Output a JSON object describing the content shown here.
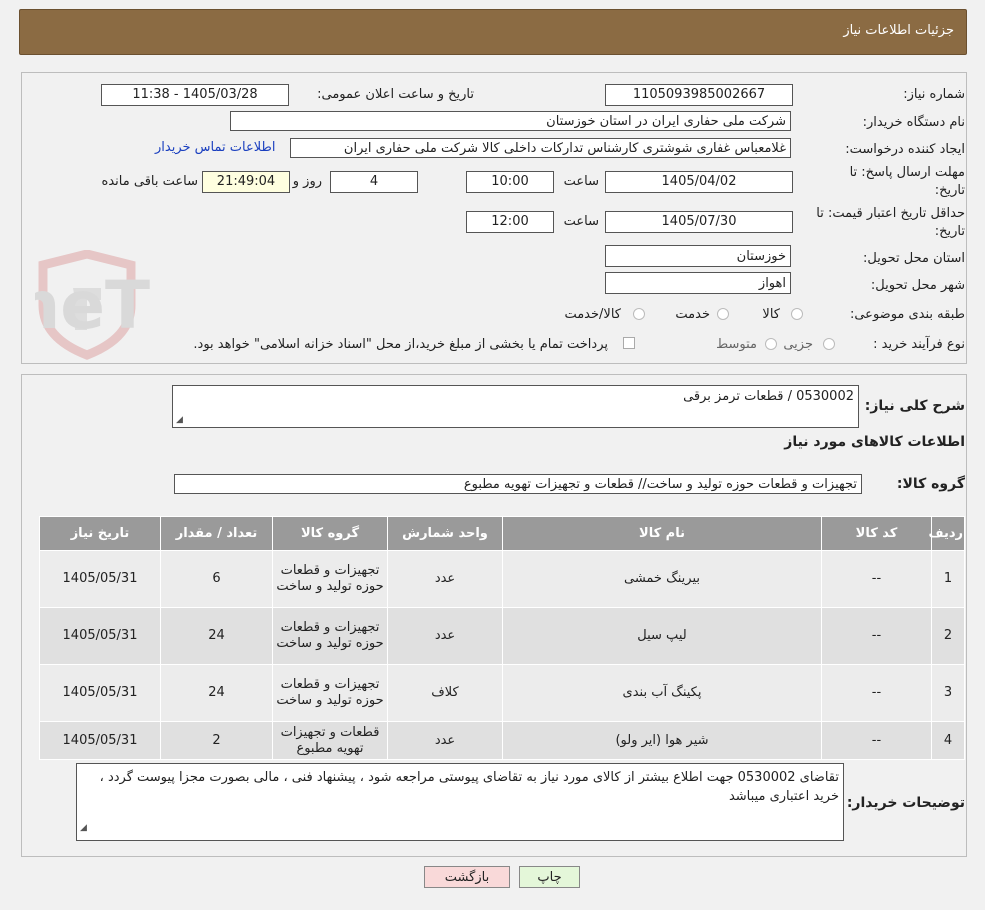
{
  "header": {
    "title": "جزئیات اطلاعات نیاز"
  },
  "fields": {
    "need_number_label": "شماره نیاز:",
    "need_number": "1105093985002667",
    "announce_label": "تاریخ و ساعت اعلان عمومی:",
    "announce_value": "1405/03/28 - 11:38",
    "buyer_org_label": "نام دستگاه خریدار:",
    "buyer_org": "شرکت ملی حفاری ایران در استان خوزستان",
    "creator_label": "ایجاد کننده درخواست:",
    "creator": "غلامعباس غفاری شوشتری کارشناس تدارکات داخلی کالا شرکت ملی حفاری ایران",
    "contact_link": "اطلاعات تماس خریدار",
    "deadline_label_1": "مهلت ارسال پاسخ: تا",
    "deadline_label_2": "تاریخ:",
    "deadline_date": "1405/04/02",
    "time_label": "ساعت",
    "deadline_time": "10:00",
    "days_value": "4",
    "days_label": "روز و",
    "remaining_time": "21:49:04",
    "remaining_label": "ساعت باقی مانده",
    "validity_label_1": "حداقل تاریخ اعتبار قیمت: تا",
    "validity_label_2": "تاریخ:",
    "validity_date": "1405/07/30",
    "validity_time": "12:00",
    "province_label": "استان محل تحویل:",
    "province": "خوزستان",
    "city_label": "شهر محل تحویل:",
    "city": "اهواز",
    "category_label": "طبقه بندی موضوعی:",
    "category_options": [
      "کالا",
      "خدمت",
      "کالا/خدمت"
    ],
    "process_label": "نوع فرآیند خرید :",
    "process_options": [
      "جزیی",
      "متوسط"
    ],
    "payment_note": "پرداخت تمام یا بخشی از مبلغ خرید،از محل \"اسناد خزانه اسلامی\" خواهد بود."
  },
  "summary": {
    "desc_label": "شرح کلی نیاز:",
    "desc_value": "0530002  /  قطعات ترمز برقی",
    "items_heading": "اطلاعات کالاهای مورد نیاز",
    "group_label": "گروه کالا:",
    "group_value": "تجهیزات و قطعات حوزه تولید و ساخت//  قطعات و تجهیزات تهویه مطبوع"
  },
  "table": {
    "headers": [
      "ردیف",
      "کد کالا",
      "نام کالا",
      "واحد شمارش",
      "گروه کالا",
      "تعداد / مقدار",
      "تاریخ نیاز"
    ],
    "rows": [
      [
        "1",
        "--",
        "بیرینگ خمشی",
        "عدد",
        "تجهیزات و قطعات حوزه تولید و ساخت",
        "6",
        "1405/05/31"
      ],
      [
        "2",
        "--",
        "لیپ سیل",
        "عدد",
        "تجهیزات و قطعات حوزه تولید و ساخت",
        "24",
        "1405/05/31"
      ],
      [
        "3",
        "--",
        "پکینگ آب بندی",
        "کلاف",
        "تجهیزات و قطعات حوزه تولید و ساخت",
        "24",
        "1405/05/31"
      ],
      [
        "4",
        "--",
        "شیر هوا (ایر ولو)",
        "عدد",
        "قطعات و تجهیزات تهویه مطبوع",
        "2",
        "1405/05/31"
      ]
    ]
  },
  "buyer_notes": {
    "label": "توضیحات خریدار:",
    "text": "تقاضای 0530002 جهت اطلاع بیشتر از کالای مورد نیاز به تقاضای پیوستی مراجعه شود ، پیشنهاد فنی ، مالی بصورت مجزا پیوست گردد ، خرید اعتباری میباشد"
  },
  "buttons": {
    "print": "چاپ",
    "back": "بازگشت"
  },
  "watermark": {
    "text": "AriaTender.neT"
  },
  "colors": {
    "header_bg": "#8b6b43",
    "back_btn_bg": "#f9d9d9",
    "print_btn_bg": "#e4f7d9",
    "table_header_bg": "#9a9a9a"
  }
}
